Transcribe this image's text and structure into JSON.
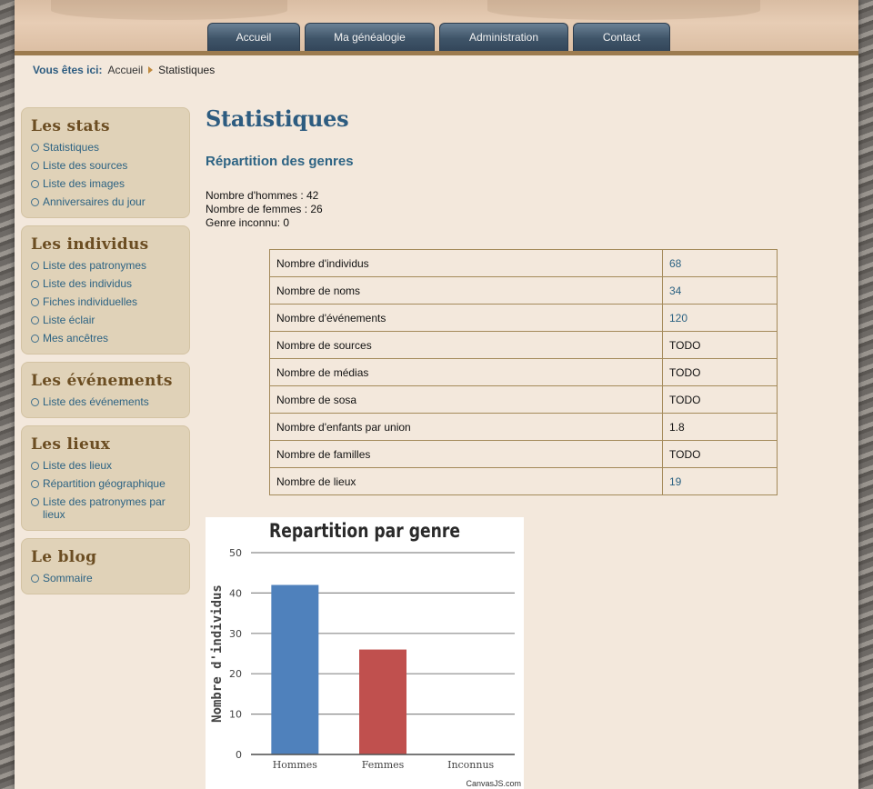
{
  "nav": {
    "items": [
      {
        "label": "Accueil"
      },
      {
        "label": "Ma généalogie"
      },
      {
        "label": "Administration"
      },
      {
        "label": "Contact"
      }
    ]
  },
  "breadcrumb": {
    "label": "Vous êtes ici:",
    "items": [
      "Accueil",
      "Statistiques"
    ]
  },
  "sidebar": {
    "boxes": [
      {
        "title": "Les stats",
        "items": [
          "Statistiques",
          "Liste des sources",
          "Liste des images",
          "Anniversaires du jour"
        ]
      },
      {
        "title": "Les individus",
        "items": [
          "Liste des patronymes",
          "Liste des individus",
          "Fiches individuelles",
          "Liste éclair",
          "Mes ancêtres"
        ]
      },
      {
        "title": "Les événements",
        "items": [
          "Liste des événements"
        ]
      },
      {
        "title": "Les lieux",
        "items": [
          "Liste des lieux",
          "Répartition géographique",
          "Liste des patronymes par lieux"
        ]
      },
      {
        "title": "Le blog",
        "items": [
          "Sommaire"
        ]
      }
    ]
  },
  "main": {
    "title": "Statistiques",
    "section_title": "Répartition des genres",
    "counts": [
      "Nombre d'hommes : 42",
      "Nombre de femmes : 26",
      "Genre inconnu: 0"
    ]
  },
  "stats_table": [
    {
      "label": "Nombre d'individus",
      "value": "68",
      "link": true
    },
    {
      "label": "Nombre de noms",
      "value": "34",
      "link": true
    },
    {
      "label": "Nombre d'événements",
      "value": "120",
      "link": true
    },
    {
      "label": "Nombre de sources",
      "value": "TODO",
      "link": false
    },
    {
      "label": "Nombre de médias",
      "value": "TODO",
      "link": false
    },
    {
      "label": "Nombre de sosa",
      "value": "TODO",
      "link": false
    },
    {
      "label": "Nombre d'enfants par union",
      "value": "1.8",
      "link": false
    },
    {
      "label": "Nombre de familles",
      "value": "TODO",
      "link": false
    },
    {
      "label": "Nombre de lieux",
      "value": "19",
      "link": true
    }
  ],
  "chart_data": {
    "type": "bar",
    "title": "Repartition par genre",
    "xlabel": "",
    "ylabel": "Nombre d'individus",
    "categories": [
      "Hommes",
      "Femmes",
      "Inconnus"
    ],
    "values": [
      42,
      26,
      0
    ],
    "colors": [
      "#4f81bc",
      "#c0504e",
      "#9bbb58"
    ],
    "ylim": [
      0,
      50
    ],
    "yticks": [
      0,
      10,
      20,
      30,
      40,
      50
    ],
    "grid": true,
    "credit": "CanvasJS.com"
  }
}
